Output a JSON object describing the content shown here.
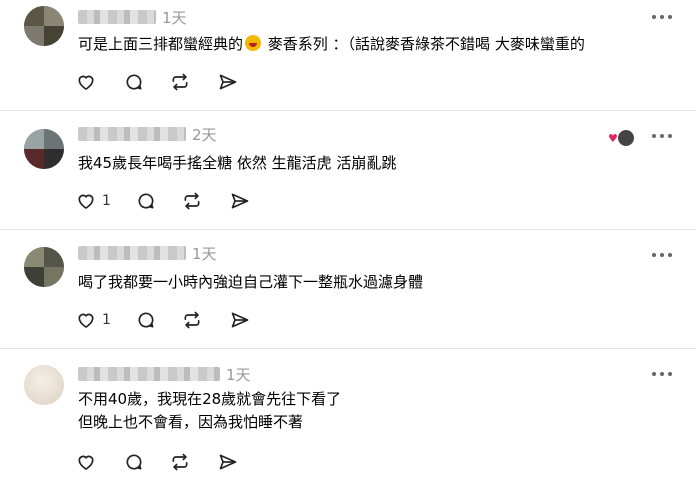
{
  "comments": [
    {
      "time": "1天",
      "text_before": "可是上面三排都蠻經典的",
      "emoji": "laughing-face-emoji",
      "text_after": " 麥香系列 ：（話說麥香綠茶不錯喝 大麥味蠻重的",
      "like_count": "",
      "has_reactions": false
    },
    {
      "time": "2天",
      "lines": [
        "我45歲長年喝手搖全糖 依然 生龍活虎 活崩亂跳"
      ],
      "like_count": "1",
      "has_reactions": true
    },
    {
      "time": "1天",
      "lines": [
        "喝了我都要一小時內強迫自己灌下一整瓶水過濾身體"
      ],
      "like_count": "1",
      "has_reactions": false
    },
    {
      "time": "1天",
      "lines": [
        "不用40歲，我現在28歲就會先往下看了",
        "但晚上也不會看，因為我怕睡不著"
      ],
      "like_count": "",
      "has_reactions": false
    }
  ],
  "icons": {
    "like": "heart-icon",
    "reply": "comment-icon",
    "repost": "repost-icon",
    "share": "send-icon",
    "more": "more-icon"
  },
  "colors": {
    "divider": "#e3e3e3",
    "muted": "#999999",
    "reaction_heart": "#e0245e"
  }
}
